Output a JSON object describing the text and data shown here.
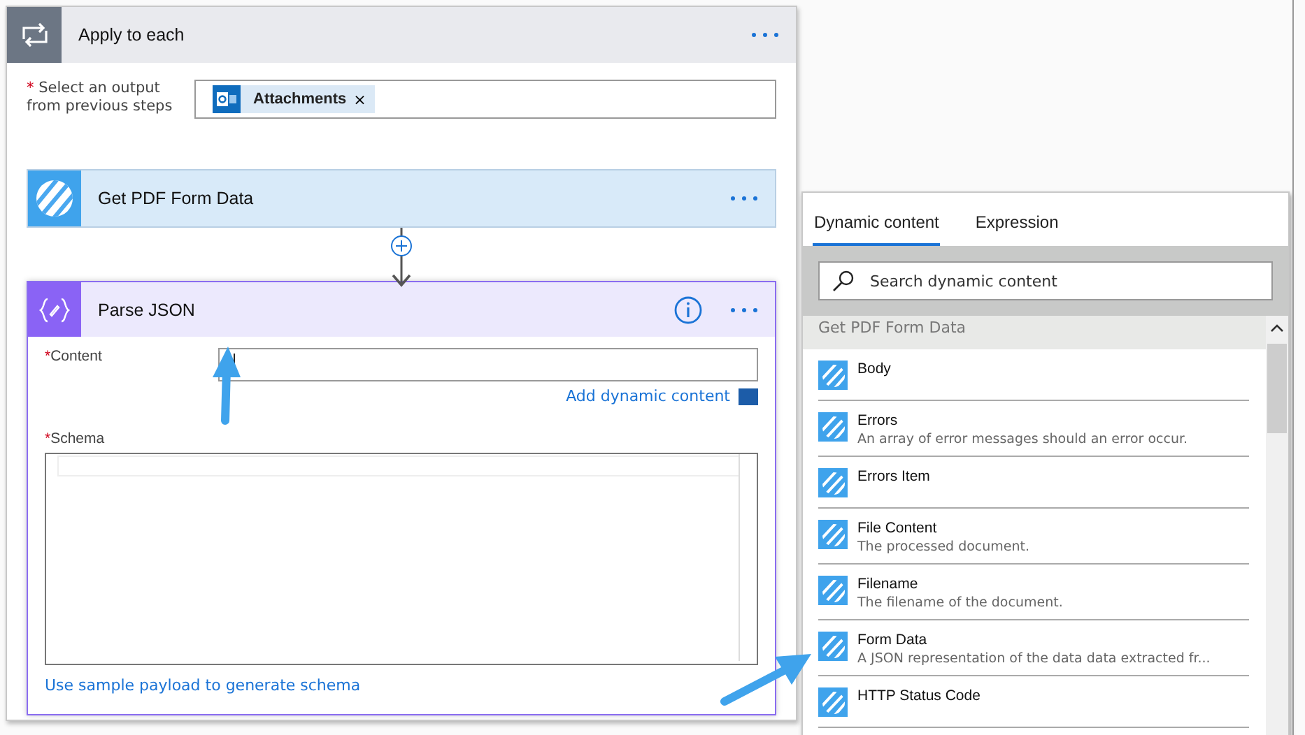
{
  "loop": {
    "title": "Apply to each",
    "required_mark": "*",
    "field_label": "Select an output from previous steps",
    "token": "Attachments",
    "token_remove": "×"
  },
  "pdf_step": {
    "title": "Get PDF Form Data"
  },
  "parse_step": {
    "title": "Parse JSON",
    "content_required_mark": "*",
    "schema_required_mark": "*",
    "content_label": "Content",
    "add_dynamic": "Add dynamic content",
    "schema_label": "Schema",
    "sample_link": "Use sample payload to generate schema"
  },
  "panel": {
    "tabs": [
      {
        "label": "Dynamic content",
        "selected": true
      },
      {
        "label": "Expression",
        "selected": false
      }
    ],
    "search": {
      "placeholder": "Search dynamic content"
    },
    "section": "Get PDF Form Data",
    "items": [
      {
        "title": "Body"
      },
      {
        "title": "Errors",
        "description": "An array of error messages should an error occur."
      },
      {
        "title": "Errors Item"
      },
      {
        "title": "File Content",
        "description": "The processed document."
      },
      {
        "title": "Filename",
        "description": "The filename of the document."
      },
      {
        "title": "Form Data",
        "description": "A JSON representation of the data data extracted fr..."
      },
      {
        "title": "HTTP Status Code"
      }
    ]
  }
}
